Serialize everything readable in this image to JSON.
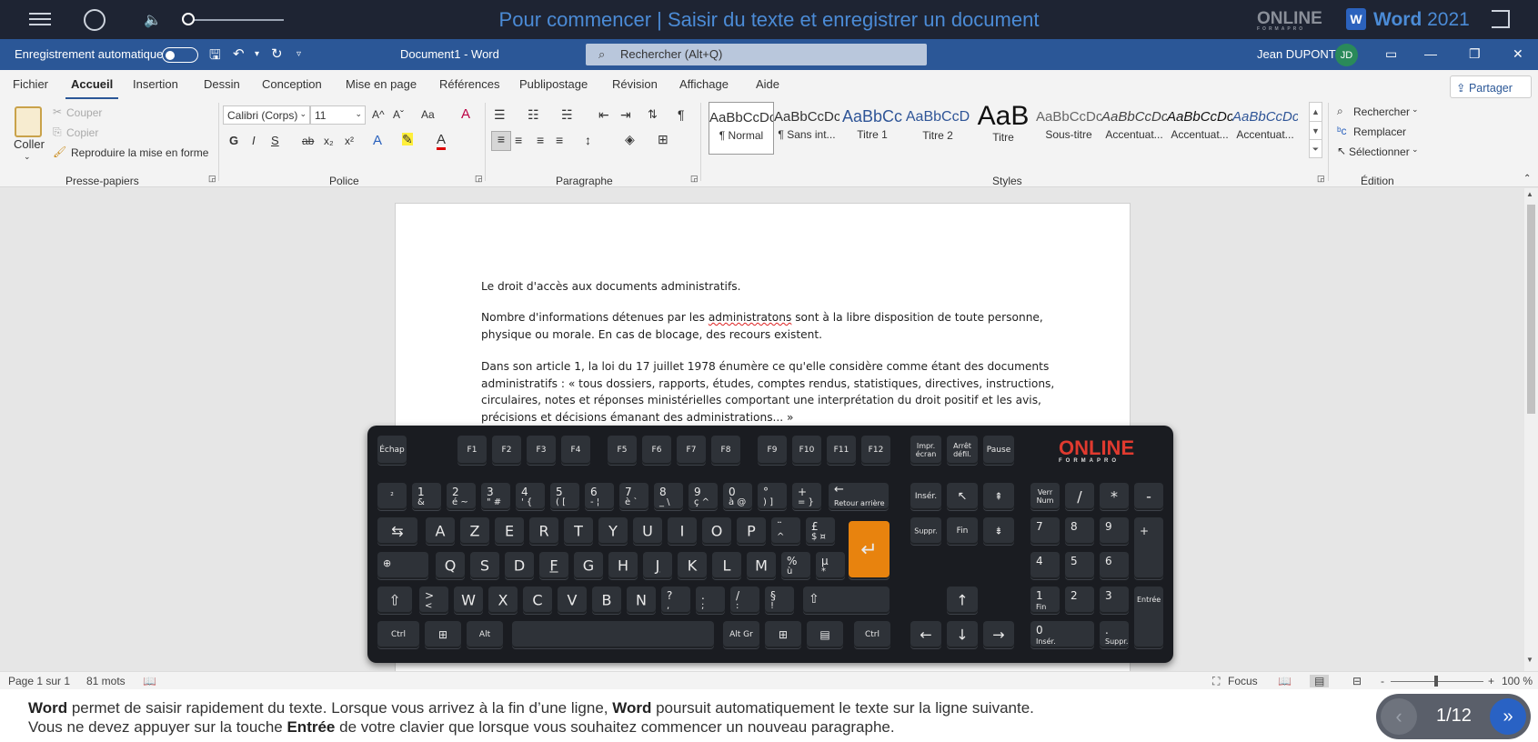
{
  "player": {
    "title": "Pour commencer | Saisir du texte et enregistrer un document",
    "logo": "ONLINE",
    "logo_sub": "FORMAPRO",
    "app_name": "Word",
    "app_year": "2021"
  },
  "titlebar": {
    "autosave_label": "Enregistrement automatique",
    "doc_title": "Document1 - Word",
    "search_placeholder": "Rechercher (Alt+Q)",
    "user_name": "Jean DUPONT",
    "user_initials": "JD"
  },
  "tabs": [
    "Fichier",
    "Accueil",
    "Insertion",
    "Dessin",
    "Conception",
    "Mise en page",
    "Références",
    "Publipostage",
    "Révision",
    "Affichage",
    "Aide"
  ],
  "active_tab": "Accueil",
  "share_label": "Partager",
  "clipboard": {
    "paste": "Coller",
    "cut": "Couper",
    "copy": "Copier",
    "format_painter": "Reproduire la mise en forme",
    "group": "Presse-papiers"
  },
  "font": {
    "name": "Calibri (Corps)",
    "size": "11",
    "group": "Police",
    "bold": "G",
    "italic": "I",
    "underline": "S",
    "strike": "ab",
    "subscript": "x₂",
    "superscript": "x²",
    "case": "Aa",
    "grow": "A^",
    "shrink": "Aˇ"
  },
  "paragraph": {
    "group": "Paragraphe",
    "pilcrow": "¶"
  },
  "styles": {
    "group": "Styles",
    "items": [
      {
        "preview": "AaBbCcDc",
        "name": "¶ Normal"
      },
      {
        "preview": "AaBbCcDc",
        "name": "¶ Sans int..."
      },
      {
        "preview": "AaBbCc",
        "name": "Titre 1"
      },
      {
        "preview": "AaBbCcD",
        "name": "Titre 2"
      },
      {
        "preview": "AaB",
        "name": "Titre"
      },
      {
        "preview": "AaBbCcDc",
        "name": "Sous-titre"
      },
      {
        "preview": "AaBbCcDc",
        "name": "Accentuat..."
      },
      {
        "preview": "AaBbCcDc",
        "name": "Accentuat..."
      },
      {
        "preview": "AaBbCcDc",
        "name": "Accentuat..."
      }
    ]
  },
  "editing": {
    "group": "Édition",
    "find": "Rechercher",
    "replace": "Remplacer",
    "select": "Sélectionner"
  },
  "document": {
    "p1": "Le droit d'accès aux documents administratifs.",
    "p2a": "Nombre d'informations détenues par les ",
    "p2_misspelled": "administratons",
    "p2b": " sont à la libre disposition de toute personne, physique ou morale. En cas de blocage, des recours existent.",
    "p3": "Dans son article 1, la loi du 17 juillet 1978 énumère ce qu'elle considère comme étant des documents administratifs : « tous dossiers, rapports, études, comptes rendus, statistiques, directives, instructions, circulaires, notes et réponses ministérielles comportant une interprétation du droit positif et les avis, précisions et décisions émanant des administrations... »"
  },
  "keyboard": {
    "logo": "ONLINE",
    "logo_sub": "FORMAPRO",
    "fn_row": [
      "Échap",
      "F1",
      "F2",
      "F3",
      "F4",
      "F5",
      "F6",
      "F7",
      "F8",
      "F9",
      "F10",
      "F11",
      "F12",
      "Impr. écran",
      "Arrêt défil.",
      "Pause"
    ],
    "backspace": "Retour arrière",
    "row_letters1": [
      "A",
      "Z",
      "E",
      "R",
      "T",
      "Y",
      "U",
      "I",
      "O",
      "P"
    ],
    "row_letters2": [
      "Q",
      "S",
      "D",
      "F",
      "G",
      "H",
      "J",
      "K",
      "L",
      "M"
    ],
    "row_letters3": [
      "W",
      "X",
      "C",
      "V",
      "B",
      "N"
    ],
    "insert": "Insér.",
    "home": "↖",
    "suppr": "Suppr.",
    "end": "Fin",
    "numlock": "Verr Num",
    "enter_num": "Entrée",
    "ctrl": "Ctrl",
    "alt": "Alt",
    "altgr": "Alt Gr",
    "num_zero_sub": "Insér.",
    "num_dot_sub": "Suppr.",
    "num_one_sub": "Fin"
  },
  "status": {
    "page": "Page 1 sur 1",
    "words": "81 mots",
    "focus": "Focus",
    "zoom": "100 %"
  },
  "caption": {
    "l1_b1": "Word",
    "l1_t1": " permet de saisir rapidement du texte. Lorsque vous arrivez à la fin d’une ligne, ",
    "l1_b2": "Word",
    "l1_t2": " poursuit automatiquement le texte sur la ligne suivante.",
    "l2_t1": "Vous ne devez appuyer sur la touche ",
    "l2_b1": "Entrée",
    "l2_t2": " de votre clavier que lorsque vous souhaitez commencer un nouveau paragraphe."
  },
  "nav": {
    "counter": "1/12",
    "current_slide": 1,
    "total_slides": 12
  },
  "colors": {
    "accent": "#2b5797",
    "enter_key": "#e8830e",
    "player_title": "#4b8bd6"
  }
}
